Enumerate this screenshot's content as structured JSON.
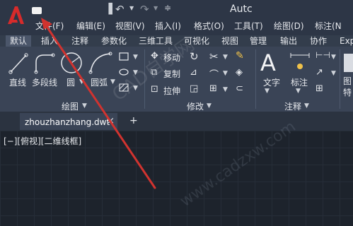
{
  "app": {
    "title": "Autc",
    "accent": "#d62b2b"
  },
  "quick_access": {
    "save_icon": "save-icon",
    "undo_icon": "undo-icon",
    "redo_icon": "redo-icon"
  },
  "menu": [
    "文件(F)",
    "编辑(E)",
    "视图(V)",
    "插入(I)",
    "格式(O)",
    "工具(T)",
    "绘图(D)",
    "标注(N"
  ],
  "ribbon_tabs": [
    "默认",
    "插入",
    "注释",
    "参数化",
    "三维工具",
    "可视化",
    "视图",
    "管理",
    "输出",
    "协作",
    "Exp"
  ],
  "draw_panel": {
    "tools": [
      "直线",
      "多段线",
      "圆",
      "圆弧"
    ],
    "title": "绘图"
  },
  "modify_panel": {
    "tools": [
      "移动",
      "复制",
      "拉伸"
    ],
    "title": "修改"
  },
  "annotation_panel": {
    "tools": [
      "文字",
      "标注"
    ],
    "title": "注释"
  },
  "extra_panel": {
    "tools": [
      "图",
      "特"
    ]
  },
  "document": {
    "tab_name": "zhouzhanzhang.dwt",
    "close": "×",
    "new_tab": "+"
  },
  "viewport": {
    "label": "[−][俯视][二维线框]"
  },
  "watermark": {
    "text": "CAD自学网",
    "url": "www.cadzxw.com"
  },
  "annotation_arrow_color": "#d1332f"
}
